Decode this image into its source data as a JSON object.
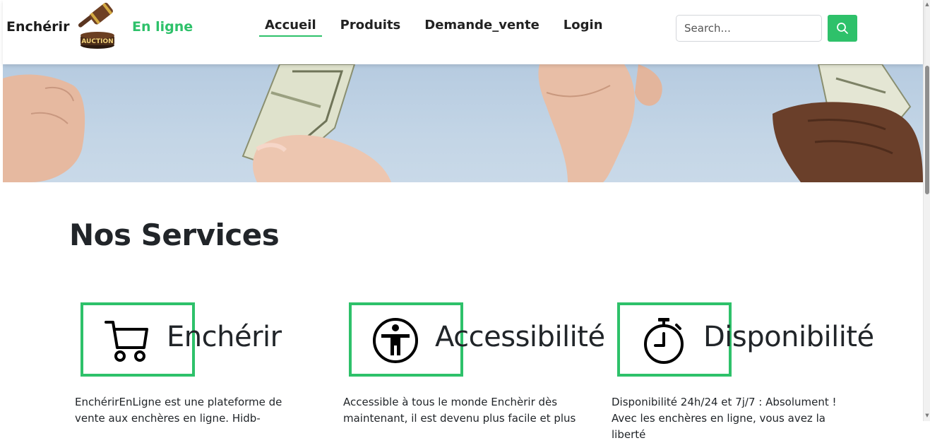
{
  "header": {
    "brand_left": "Enchérir",
    "logo_text": "AUCTION",
    "brand_right": "En ligne",
    "nav": [
      {
        "label": "Accueil",
        "active": true
      },
      {
        "label": "Produits",
        "active": false
      },
      {
        "label": "Demande_vente",
        "active": false
      },
      {
        "label": "Login",
        "active": false
      }
    ],
    "search": {
      "placeholder": "Search...",
      "value": "",
      "button_icon": "search-icon"
    }
  },
  "hero": {
    "icon": "money-hands-image"
  },
  "services": {
    "title": "Nos Services",
    "items": [
      {
        "title": "Enchérir",
        "icon": "cart-icon",
        "desc": "EnchérirEnLigne est une plateforme de vente aux enchères en ligne. Hidb-"
      },
      {
        "title": "Accessibilité",
        "icon": "accessibility-icon",
        "desc": "Accessible à tous le monde Enchèrir dès maintenant, il est devenu plus facile et plus"
      },
      {
        "title": "Disponibilité",
        "icon": "stopwatch-icon",
        "desc": "Disponibilité 24h/24 et 7j/7 : Absolument ! Avec les enchères en ligne, vous avez la liberté"
      }
    ]
  },
  "colors": {
    "accent": "#2ec16a",
    "text": "#212529",
    "hero_bg": "#c3d5e6"
  }
}
